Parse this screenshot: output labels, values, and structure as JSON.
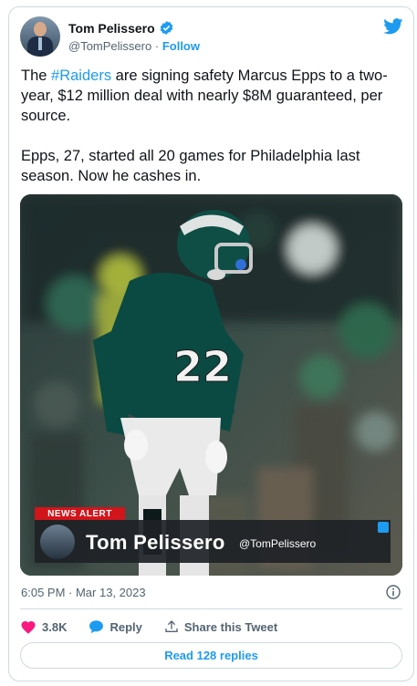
{
  "author": {
    "name": "Tom Pelissero",
    "handle": "@TomPelissero",
    "follow_label": "Follow",
    "separator": "·"
  },
  "tweet": {
    "line1_pre": "The ",
    "hashtag": "#Raiders",
    "line1_post": " are signing safety Marcus Epps to a two-year, $12 million deal with nearly $8M guaranteed, per source.",
    "line2": "Epps, 27, started all 20 games for Philadelphia last season. Now he cashes in."
  },
  "media": {
    "jersey_number": "22",
    "alert_label": "NEWS ALERT",
    "overlay_name": "Tom Pelissero",
    "overlay_handle": "@TomPelissero"
  },
  "timestamp": "6:05 PM · Mar 13, 2023",
  "actions": {
    "likes": "3.8K",
    "reply_label": "Reply",
    "share_label": "Share this Tweet"
  },
  "read_replies_label": "Read 128 replies",
  "colors": {
    "brand_blue": "#1d9bf0",
    "like_pink": "#f91880",
    "text_dark": "#0f1419",
    "text_gray": "#536471",
    "alert_red": "#d2141b",
    "jersey_green": "#0b4a42"
  }
}
